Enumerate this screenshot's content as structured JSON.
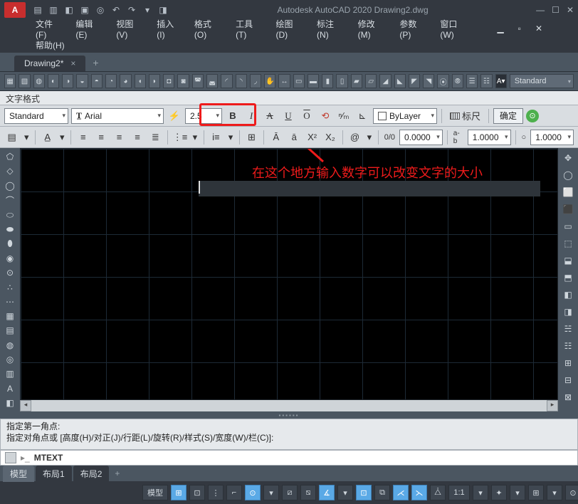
{
  "app": {
    "title": "Autodesk AutoCAD 2020   Drawing2.dwg",
    "icon_letter": "A"
  },
  "menu": {
    "items": [
      "文件(F)",
      "编辑(E)",
      "视图(V)",
      "插入(I)",
      "格式(O)",
      "工具(T)",
      "绘图(D)",
      "标注(N)",
      "修改(M)",
      "参数(P)",
      "窗口(W)"
    ],
    "help": "帮助(H)"
  },
  "doctab": {
    "label": "Drawing2*",
    "close": "×",
    "add": "+"
  },
  "toolbar": {
    "style_label": "Standard"
  },
  "fmt": {
    "panel_title": "文字格式",
    "style": "Standard",
    "font": "Arial",
    "height": "2.5",
    "bold": "B",
    "italic": "I",
    "underline": "U",
    "overline": "O",
    "bylayer": "ByLayer",
    "ruler": "标尺",
    "confirm": "确定",
    "ratio": "0/0",
    "num1": "0.0000",
    "prefix_ab": "a-b",
    "num2": "1.0000",
    "cir": "○",
    "num3": "1.0000",
    "at": "@"
  },
  "annotation": "在这个地方输入数字可以改变文字的大小",
  "cmd": {
    "line1": "指定第一角点:",
    "line2": "指定对角点或 [高度(H)/对正(J)/行距(L)/旋转(R)/样式(S)/宽度(W)/栏(C)]:",
    "input": "MTEXT"
  },
  "layout": {
    "model": "模型",
    "l1": "布局1",
    "l2": "布局2",
    "add": "+"
  },
  "status": {
    "model": "模型",
    "scale": "1:1"
  },
  "icons": {
    "qat": [
      "▤",
      "▥",
      "◧",
      "▣",
      "◎",
      "↶",
      "↷",
      "▾",
      "◨"
    ],
    "tb1": [
      "▦",
      "▧",
      "◍",
      "◐",
      "◑",
      "◒",
      "◓",
      "◔",
      "◕",
      "◖",
      "◗",
      "◘",
      "◙",
      "◚",
      "◛",
      "◜",
      "◝",
      "◞"
    ],
    "tb2": [
      "✋",
      "↔",
      "▭",
      "▬",
      "▮",
      "▯",
      "▰",
      "▱",
      "◢",
      "◣",
      "◤",
      "◥",
      "⦿",
      "⦾",
      "☰",
      "☷",
      "⌂"
    ],
    "ltool": [
      "⬠",
      "◇",
      "◯",
      "⌒",
      "⬭",
      "⬬",
      "⬮",
      "◉",
      "⊙",
      "∴",
      "⋯",
      "▦",
      "▤",
      "◍",
      "◎",
      "▥",
      "A",
      "◧"
    ],
    "rtool": [
      "✥",
      "◯",
      "⬜",
      "⬛",
      "▭",
      "⬚",
      "⬓",
      "⬒",
      "◧",
      "◨",
      "☵",
      "☷",
      "⊞",
      "⊟",
      "⊠"
    ],
    "fmt2": [
      "▤",
      "▾",
      "|",
      "A̲",
      "▾",
      "|",
      "≡",
      "≡",
      "≡",
      "≡",
      "≣",
      "|",
      "⋮≡",
      "▾",
      "|",
      "i≡",
      "▾",
      "|",
      "⊞",
      "|",
      "@",
      "|",
      "A̲",
      "a̲",
      "X",
      "X"
    ],
    "status_icons": [
      "⊞",
      "⊡",
      "⋮",
      "|",
      "⌐",
      "⊙",
      "▾",
      "⧄",
      "⧅",
      "∡",
      "▾",
      "⊡",
      "⧉",
      "⋌",
      "⋋",
      "⧊",
      "▾",
      "✦",
      "▾",
      "⊞",
      "▾",
      "⊙",
      "⊡",
      "≡"
    ]
  }
}
